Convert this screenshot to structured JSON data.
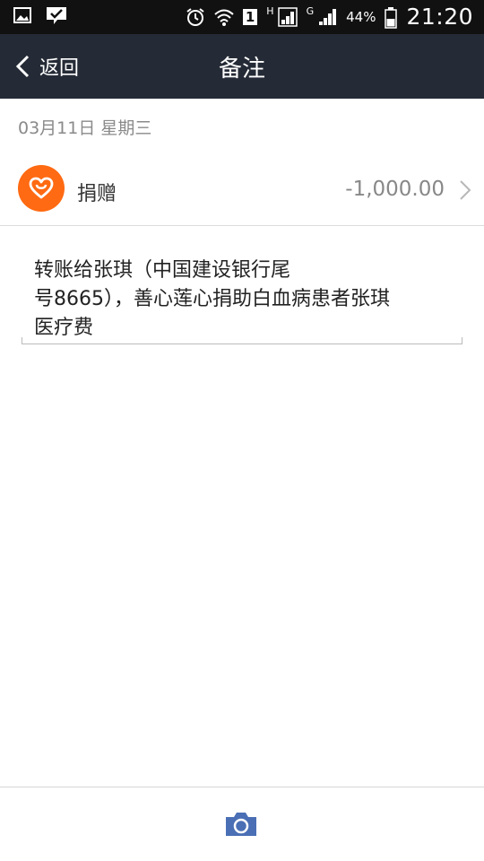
{
  "status_bar": {
    "battery": "44%",
    "time": "21:20",
    "network_h": "H",
    "network_g": "G",
    "sim_slot": "1"
  },
  "header": {
    "back_label": "返回",
    "title": "备注",
    "background": "#252b36"
  },
  "transaction": {
    "date": "03月11日 星期三",
    "name": "捐赠",
    "amount": "-1,000.00",
    "icon": "heart-icon",
    "icon_color": "#ff6a12"
  },
  "memo": {
    "text": "转账给张琪（中国建设银行尾\n号8665），善心莲心捐助白血病患者张琪\n医疗费"
  },
  "bottom_bar": {
    "camera_icon": "camera-icon",
    "camera_color": "#4a6fb5"
  }
}
